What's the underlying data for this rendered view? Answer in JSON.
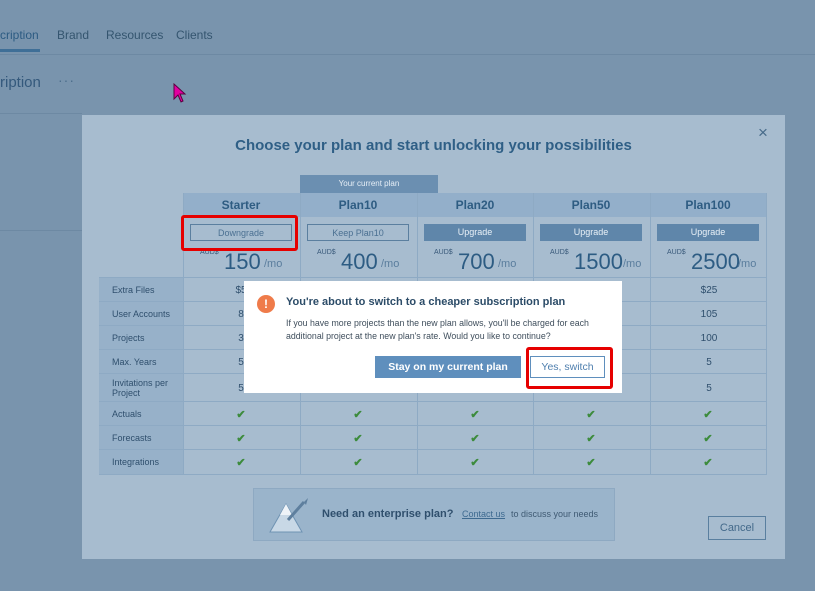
{
  "background": {
    "tabs": [
      {
        "label": "cription"
      },
      {
        "label": "Brand"
      },
      {
        "label": "Resources"
      },
      {
        "label": "Clients"
      }
    ],
    "page_title": "ription",
    "dots": "···"
  },
  "modal": {
    "title": "Choose your plan and start unlocking your possibilities",
    "close": "×",
    "current_plan_tag": "Your current plan",
    "plans": [
      {
        "name": "Starter",
        "action": "Downgrade",
        "currency": "AUD$",
        "price": "150",
        "period": "/mo"
      },
      {
        "name": "Plan10",
        "action": "Keep Plan10",
        "currency": "AUD$",
        "price": "400",
        "period": "/mo"
      },
      {
        "name": "Plan20",
        "action": "Upgrade",
        "currency": "AUD$",
        "price": "700",
        "period": "/mo"
      },
      {
        "name": "Plan50",
        "action": "Upgrade",
        "currency": "AUD$",
        "price": "1500",
        "period": "/mo"
      },
      {
        "name": "Plan100",
        "action": "Upgrade",
        "currency": "AUD$",
        "price": "2500",
        "period": "/mo"
      }
    ],
    "features": [
      {
        "label": "Extra Files",
        "values": [
          "$5",
          "",
          "",
          "",
          "$25"
        ]
      },
      {
        "label": "User Accounts",
        "values": [
          "8",
          "",
          "",
          "",
          "105"
        ]
      },
      {
        "label": "Projects",
        "values": [
          "3",
          "",
          "",
          "",
          "100"
        ]
      },
      {
        "label": "Max. Years",
        "values": [
          "5",
          "",
          "",
          "",
          "5"
        ]
      },
      {
        "label": "Invitations per Project",
        "values": [
          "5",
          "",
          "",
          "",
          "5"
        ]
      },
      {
        "label": "Actuals",
        "values": [
          "✔",
          "✔",
          "✔",
          "✔",
          "✔"
        ]
      },
      {
        "label": "Forecasts",
        "values": [
          "✔",
          "✔",
          "✔",
          "✔",
          "✔"
        ]
      },
      {
        "label": "Integrations",
        "values": [
          "✔",
          "✔",
          "✔",
          "✔",
          "✔"
        ]
      }
    ],
    "enterprise": {
      "text": "Need an enterprise plan?",
      "link": "Contact us",
      "rest": "to discuss your needs"
    },
    "cancel": "Cancel"
  },
  "dialog": {
    "icon": "!",
    "title": "You're about to switch to a cheaper subscription plan",
    "body": "If you have more projects than the new plan allows, you'll be charged for each additional project at the new plan's rate. Would you like to continue?",
    "stay_button": "Stay on my current plan",
    "yes_button": "Yes, switch"
  },
  "colors": {
    "highlight": "#e60000",
    "warning_icon": "#ef7b4a",
    "primary": "#5f8fbd"
  }
}
